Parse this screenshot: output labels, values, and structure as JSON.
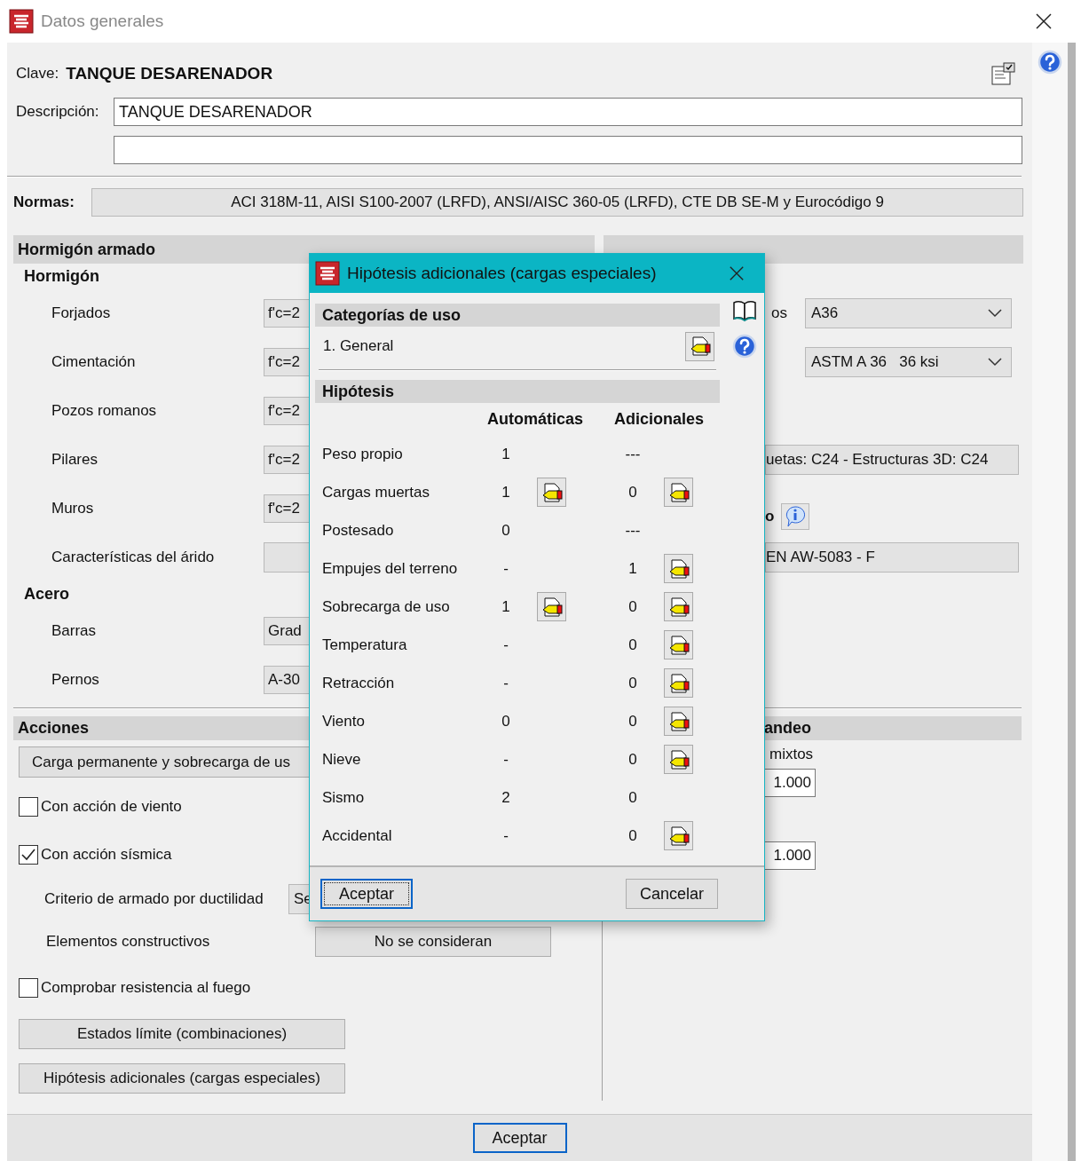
{
  "window": {
    "title": "Datos generales"
  },
  "header": {
    "clave_label": "Clave:",
    "clave_value": "TANQUE DESARENADOR",
    "description_label": "Descripción:",
    "description_value": "TANQUE DESARENADOR"
  },
  "normas": {
    "label": "Normas:",
    "value": "ACI 318M-11, AISI S100-2007 (LRFD), ANSI/AISC 360-05 (LRFD), CTE DB SE-M y Eurocódigo 9"
  },
  "hormigon_armado": {
    "title": "Hormigón armado",
    "groups": [
      {
        "title": "Hormigón",
        "rows": [
          {
            "label": "Forjados",
            "value": "f'c=2"
          },
          {
            "label": "Cimentación",
            "value": "f'c=2"
          },
          {
            "label": "Pozos romanos",
            "value": "f'c=2"
          },
          {
            "label": "Pilares",
            "value": "f'c=2"
          },
          {
            "label": "Muros",
            "value": "f'c=2"
          },
          {
            "label": "Características del árido"
          }
        ]
      },
      {
        "title": "Acero",
        "rows": [
          {
            "label": "Barras",
            "value": "Grad"
          },
          {
            "label": "Pernos",
            "value": "A-30"
          }
        ]
      }
    ]
  },
  "perfiles": {
    "rows": [
      {
        "kind": "select",
        "label": "os",
        "value": "A36"
      },
      {
        "kind": "select",
        "value": "ASTM A 36   36 ksi"
      },
      {
        "kind": "field",
        "value": "uetas: C24 - Estructuras 3D: C24"
      },
      {
        "kind": "info",
        "label": "o"
      },
      {
        "kind": "field",
        "value": "EN AW-5083 - F"
      }
    ]
  },
  "acciones": {
    "title": "Acciones",
    "button": "Carga permanente y sobrecarga de us",
    "items": [
      {
        "kind": "checkbox",
        "label": "Con acción de viento",
        "checked": false
      },
      {
        "kind": "checkbox",
        "label": "Con acción sísmica",
        "checked": true
      },
      {
        "kind": "field",
        "label": "Criterio de armado por ductilidad",
        "value": "Se"
      },
      {
        "kind": "button",
        "label": "Elementos constructivos",
        "value": "No se consideran"
      },
      {
        "kind": "checkbox",
        "label": "Comprobar resistencia al fuego",
        "checked": false
      },
      {
        "kind": "wide_button",
        "label": "Estados límite (combinaciones)"
      },
      {
        "kind": "wide_button",
        "label": "Hipótesis adicionales (cargas especiales)"
      }
    ]
  },
  "pandeo": {
    "title": "andeo",
    "note": "mixtos",
    "values": [
      "1.000",
      "1.000"
    ]
  },
  "footer": {
    "ok": {
      "label": "Aceptar",
      "focused": true
    }
  },
  "dialog": {
    "title": "Hipótesis adicionales (cargas especiales)",
    "category_title": "Categorías de uso",
    "category": "1. General",
    "hypotheses_title": "Hipótesis",
    "col_auto": "Automáticas",
    "col_add": "Adicionales",
    "rows": [
      {
        "name": "Peso propio",
        "auto": "1",
        "auto_edit": false,
        "add": "---",
        "add_edit": false
      },
      {
        "name": "Cargas muertas",
        "auto": "1",
        "auto_edit": true,
        "add": "0",
        "add_edit": true
      },
      {
        "name": "Postesado",
        "auto": "0",
        "auto_edit": false,
        "add": "---",
        "add_edit": false
      },
      {
        "name": "Empujes del terreno",
        "auto": "-",
        "auto_edit": false,
        "add": "1",
        "add_edit": true
      },
      {
        "name": "Sobrecarga de uso",
        "auto": "1",
        "auto_edit": true,
        "add": "0",
        "add_edit": true
      },
      {
        "name": "Temperatura",
        "auto": "-",
        "auto_edit": false,
        "add": "0",
        "add_edit": true
      },
      {
        "name": "Retracción",
        "auto": "-",
        "auto_edit": false,
        "add": "0",
        "add_edit": true
      },
      {
        "name": "Viento",
        "auto": "0",
        "auto_edit": false,
        "add": "0",
        "add_edit": true
      },
      {
        "name": "Nieve",
        "auto": "-",
        "auto_edit": false,
        "add": "0",
        "add_edit": true
      },
      {
        "name": "Sismo",
        "auto": "2",
        "auto_edit": false,
        "add": "0",
        "add_edit": false
      },
      {
        "name": "Accidental",
        "auto": "-",
        "auto_edit": false,
        "add": "0",
        "add_edit": true
      }
    ],
    "buttons": [
      {
        "label": "Aceptar",
        "focused": true
      },
      {
        "label": "Cancelar",
        "focused": false
      }
    ]
  }
}
